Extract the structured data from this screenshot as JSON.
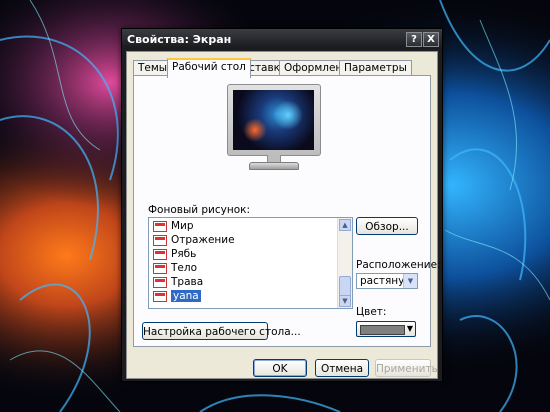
{
  "window": {
    "title": "Свойства: Экран",
    "help_btn": "?",
    "close_btn": "X"
  },
  "tabs": [
    "Темы",
    "Рабочий стол",
    "Заставка",
    "Оформление",
    "Параметры"
  ],
  "active_tab": "Рабочий стол",
  "background_label": "Фоновый рисунок:",
  "background_items": [
    "Мир",
    "Отражение",
    "Рябь",
    "Тело",
    "Трава",
    "yana"
  ],
  "selected_background": "yana",
  "browse_button": "Обзор...",
  "position_label": "Расположение:",
  "position_value": "растянуть",
  "color_label": "Цвет:",
  "color_value": "#808080",
  "customize_button": "Настройка рабочего стола...",
  "footer": {
    "ok": "OK",
    "cancel": "Отмена",
    "apply": "Применить"
  }
}
